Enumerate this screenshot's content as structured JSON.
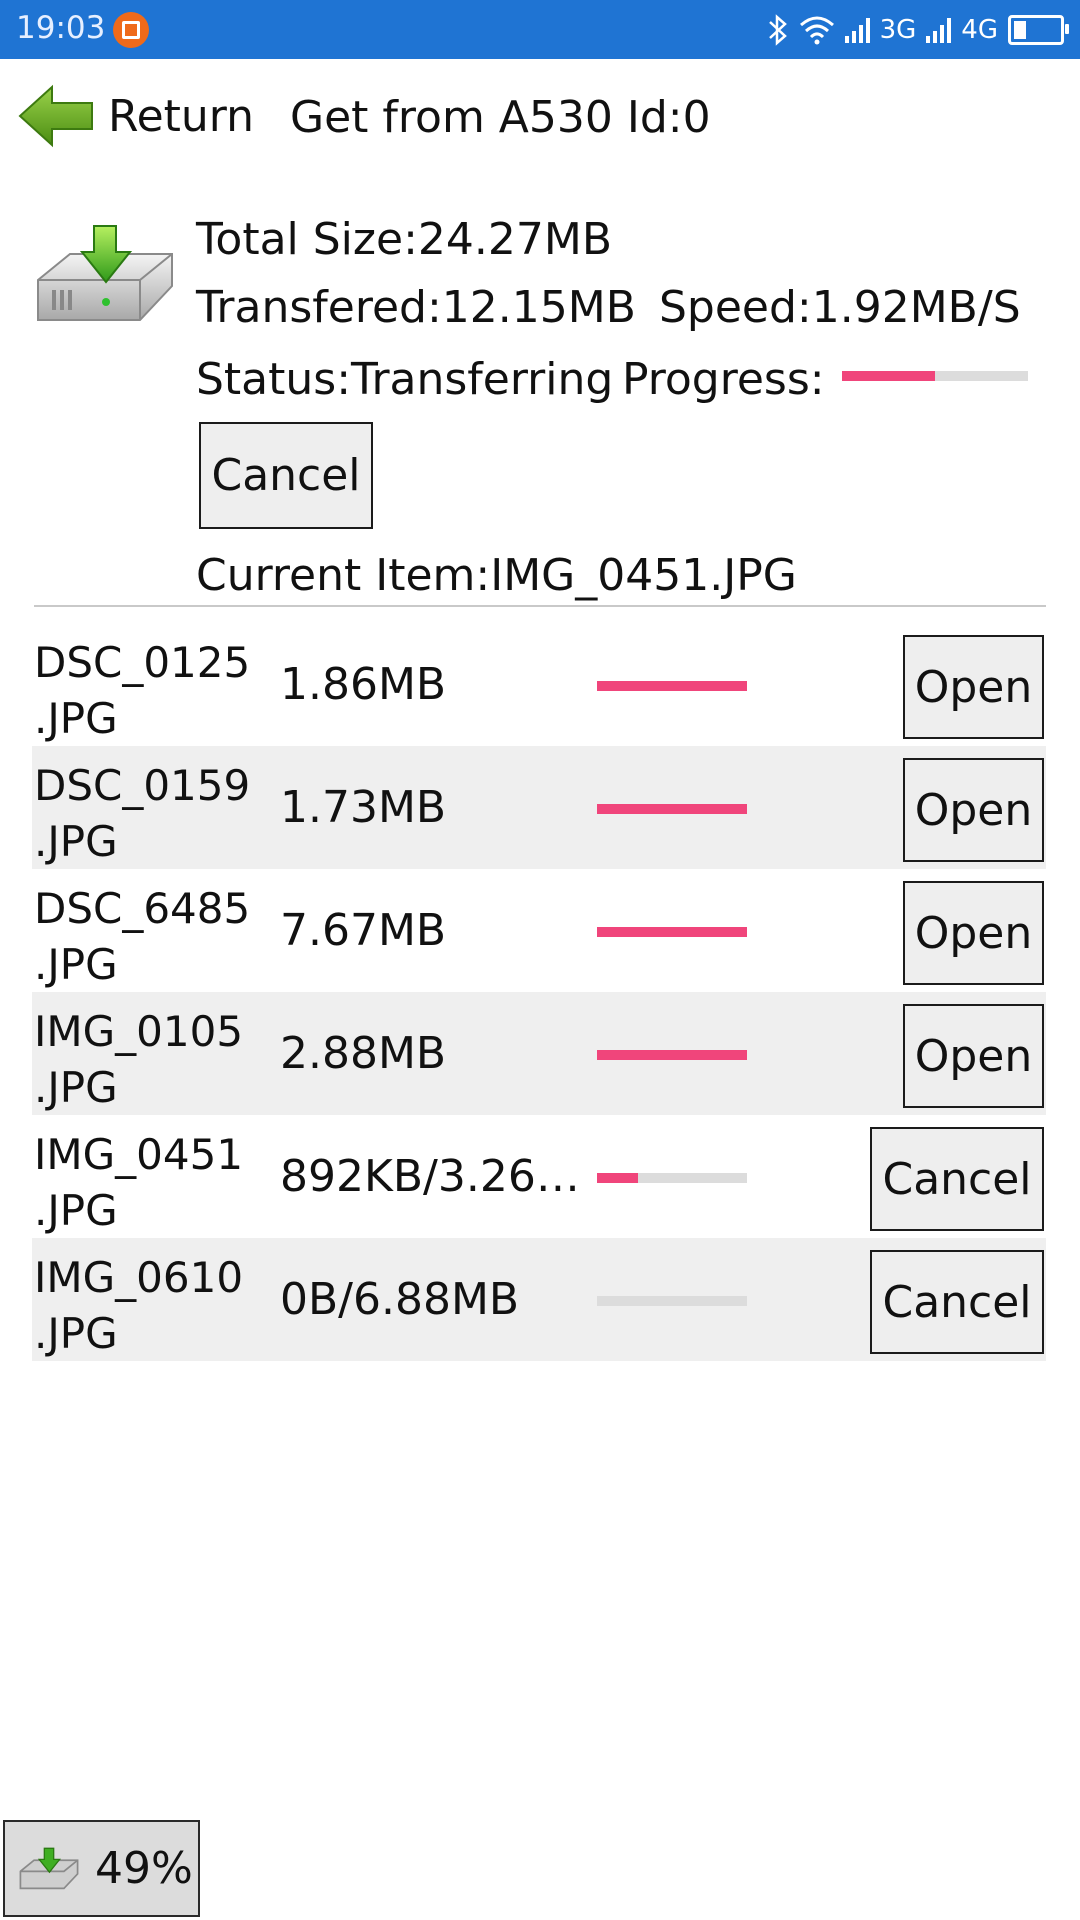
{
  "status_bar": {
    "time": "19:03",
    "network_3g": "3G",
    "network_4g": "4G",
    "battery_icon": "battery-low-icon"
  },
  "header": {
    "return_label": "Return",
    "title": "Get from A530 Id:0"
  },
  "transfer": {
    "total_size": "Total Size:24.27MB",
    "transferred": "Transfered:12.15MB",
    "speed": "Speed:1.92MB/S",
    "status": "Status:Transferring",
    "progress_label": "Progress:",
    "progress": 0.5,
    "cancel_label": "Cancel",
    "current_item": "Current Item:IMG_0451.JPG"
  },
  "files": [
    {
      "name_line1": "DSC_0125",
      "name_line2": ".JPG",
      "size": "1.86MB",
      "progress": 1.0,
      "action": "Open"
    },
    {
      "name_line1": "DSC_0159",
      "name_line2": ".JPG",
      "size": "1.73MB",
      "progress": 1.0,
      "action": "Open"
    },
    {
      "name_line1": "DSC_6485",
      "name_line2": ".JPG",
      "size": "7.67MB",
      "progress": 1.0,
      "action": "Open"
    },
    {
      "name_line1": "IMG_0105",
      "name_line2": ".JPG",
      "size": "2.88MB",
      "progress": 1.0,
      "action": "Open"
    },
    {
      "name_line1": "IMG_0451",
      "name_line2": ".JPG",
      "size": "892KB/3.26…",
      "progress": 0.27,
      "action": "Cancel"
    },
    {
      "name_line1": "IMG_0610",
      "name_line2": ".JPG",
      "size": "0B/6.88MB",
      "progress": 0.0,
      "action": "Cancel"
    }
  ],
  "floating_widget": {
    "percent": "49%"
  },
  "colors": {
    "status_bar": "#1f74d3",
    "progress_fill": "#f0457b",
    "progress_track": "#dcdcdc",
    "row_alt_bg": "#efefef",
    "return_arrow": "#6cae2a"
  }
}
